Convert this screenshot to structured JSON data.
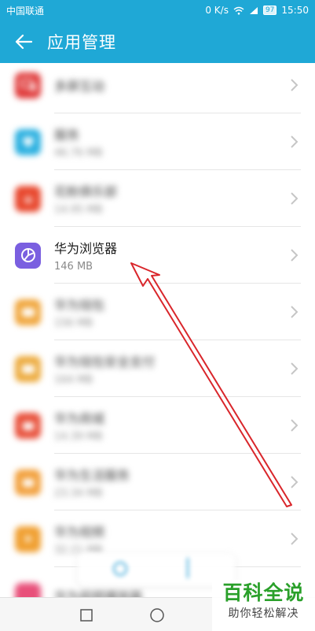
{
  "status_bar": {
    "carrier": "中国联通",
    "net_speed": "0 K/s",
    "battery": "97",
    "time": "15:50"
  },
  "app_bar": {
    "title": "应用管理"
  },
  "apps": [
    {
      "name": "多屏互动",
      "size": ""
    },
    {
      "name": "服务",
      "size": "46.76 MB"
    },
    {
      "name": "花粉俱乐部",
      "size": "14.95 MB"
    },
    {
      "name": "华为浏览器",
      "size": "146 MB"
    },
    {
      "name": "华为钱包",
      "size": "156 MB"
    },
    {
      "name": "华为钱包安全支付",
      "size": "164 MB"
    },
    {
      "name": "华为商城",
      "size": "14.39 MB"
    },
    {
      "name": "华为生活服务",
      "size": "23.34 MB"
    },
    {
      "name": "华为视频",
      "size": "32.21 MB"
    },
    {
      "name": "华为视频播放器",
      "size": ""
    }
  ],
  "watermark": {
    "main": "百科全说",
    "sub": "助你轻松解决"
  },
  "colors": {
    "accent": "#1fa8d6",
    "annotation_arrow": "#d9262b",
    "watermark_green": "#2aa02a"
  }
}
